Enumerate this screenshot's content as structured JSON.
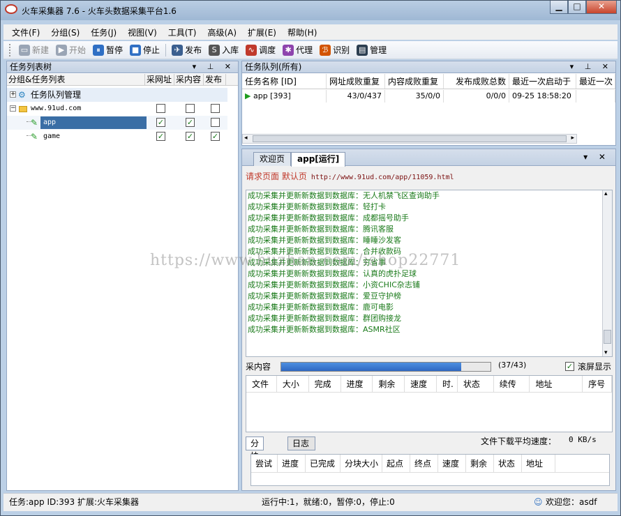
{
  "window": {
    "title": "火车采集器 7.6 - 火车头数据采集平台1.6",
    "min_label": "▁",
    "max_label": "□",
    "close_label": "✕"
  },
  "menu": [
    "文件(F)",
    "分组(S)",
    "任务(J)",
    "视图(V)",
    "工具(T)",
    "高级(A)",
    "扩展(E)",
    "帮助(H)"
  ],
  "toolbar": [
    {
      "label": "新建",
      "icon": "new-file-icon",
      "glyph": "▭",
      "color": "#9aa5b5",
      "disabled": true
    },
    {
      "label": "开始",
      "icon": "play-icon",
      "glyph": "▶",
      "color": "#9aa5b5",
      "disabled": true
    },
    {
      "label": "暂停",
      "icon": "pause-icon",
      "glyph": "⏸",
      "color": "#2f6fc4",
      "disabled": false
    },
    {
      "label": "停止",
      "icon": "stop-icon",
      "glyph": "■",
      "color": "#2f6fc4",
      "disabled": false
    },
    {
      "label": "发布",
      "icon": "publish-icon",
      "glyph": "✈",
      "color": "#3b5f8f",
      "disabled": false
    },
    {
      "label": "入库",
      "icon": "sql-icon",
      "glyph": "S",
      "color": "#555555",
      "disabled": false
    },
    {
      "label": "调度",
      "icon": "schedule-icon",
      "glyph": "∿",
      "color": "#c0392b",
      "disabled": false
    },
    {
      "label": "代理",
      "icon": "proxy-icon",
      "glyph": "✱",
      "color": "#8e44ad",
      "disabled": false
    },
    {
      "label": "识别",
      "icon": "captcha-icon",
      "glyph": "ℬ",
      "color": "#d35400",
      "disabled": false
    },
    {
      "label": "管理",
      "icon": "manage-icon",
      "glyph": "▤",
      "color": "#2c3e50",
      "disabled": false
    }
  ],
  "left_panel": {
    "title": "任务列表树",
    "header_btns": "▾ ⊥ ✕",
    "columns": [
      "分组&任务列表",
      "采网址",
      "采内容",
      "发布"
    ],
    "root": "任务队列管理",
    "group": "www.91ud.com",
    "tasks": [
      {
        "name": "app",
        "c1": true,
        "c2": true,
        "c3": false,
        "selected": true
      },
      {
        "name": "game",
        "c1": true,
        "c2": true,
        "c3": true,
        "selected": false
      }
    ]
  },
  "queue": {
    "title": "任务队列(所有)",
    "header_btns": "▾ ⊥ ✕",
    "columns": [
      "任务名称 [ID]",
      "网址成败重复",
      "内容成败重复",
      "发布成败总数",
      "最近一次启动于",
      "最近一次"
    ],
    "row": [
      "app [393]",
      "43/0/437",
      "35/0/0",
      "0/0/0",
      "09-25 18:58:20",
      ""
    ]
  },
  "doc": {
    "tabs": [
      "欢迎页",
      "app[运行]"
    ],
    "tab_btns": "▾ ✕",
    "request_label": "请求页面 默认页",
    "request_url": "http://www.91ud.com/app/11059.html",
    "log_prefix": "成功采集并更新新数据到数据库：",
    "log_items": [
      "无人机禁飞区查询助手",
      "轻打卡",
      "成都摇号助手",
      "腾讯客服",
      "睡睡沙发客",
      "合并收款码",
      "穷省事",
      "认真的虎扑足球",
      "小资CHIC杂志铺",
      "爱豆守护榜",
      "鹿可电影",
      "群团购接龙",
      "ASMR社区"
    ],
    "progress_label": "采内容",
    "progress_value": 0.86,
    "progress_text": "(37/43)",
    "autoscroll_label": "滚屏显示",
    "autoscroll_checked": true,
    "download_columns": [
      "文件",
      "大小",
      "完成",
      "进度",
      "剩余",
      "速度",
      "时.",
      "状态",
      "续传",
      "地址",
      "序号"
    ],
    "sub_tabs": [
      "分块下载",
      "日志"
    ],
    "speed_label": "文件下载平均速度：",
    "speed_value": "0 KB/s",
    "chunk_columns": [
      "尝试",
      "进度",
      "已完成",
      "分块大小",
      "起点",
      "终点",
      "速度",
      "剩余",
      "状态",
      "地址"
    ]
  },
  "status": {
    "task": "任务:app  ID:393  扩展:火车采集器",
    "counts": "运行中:1，就绪:0，暂停:0，停止:0",
    "welcome": "欢迎您：asdf"
  },
  "watermark": "https://www.huzhan.com/ishop22771"
}
